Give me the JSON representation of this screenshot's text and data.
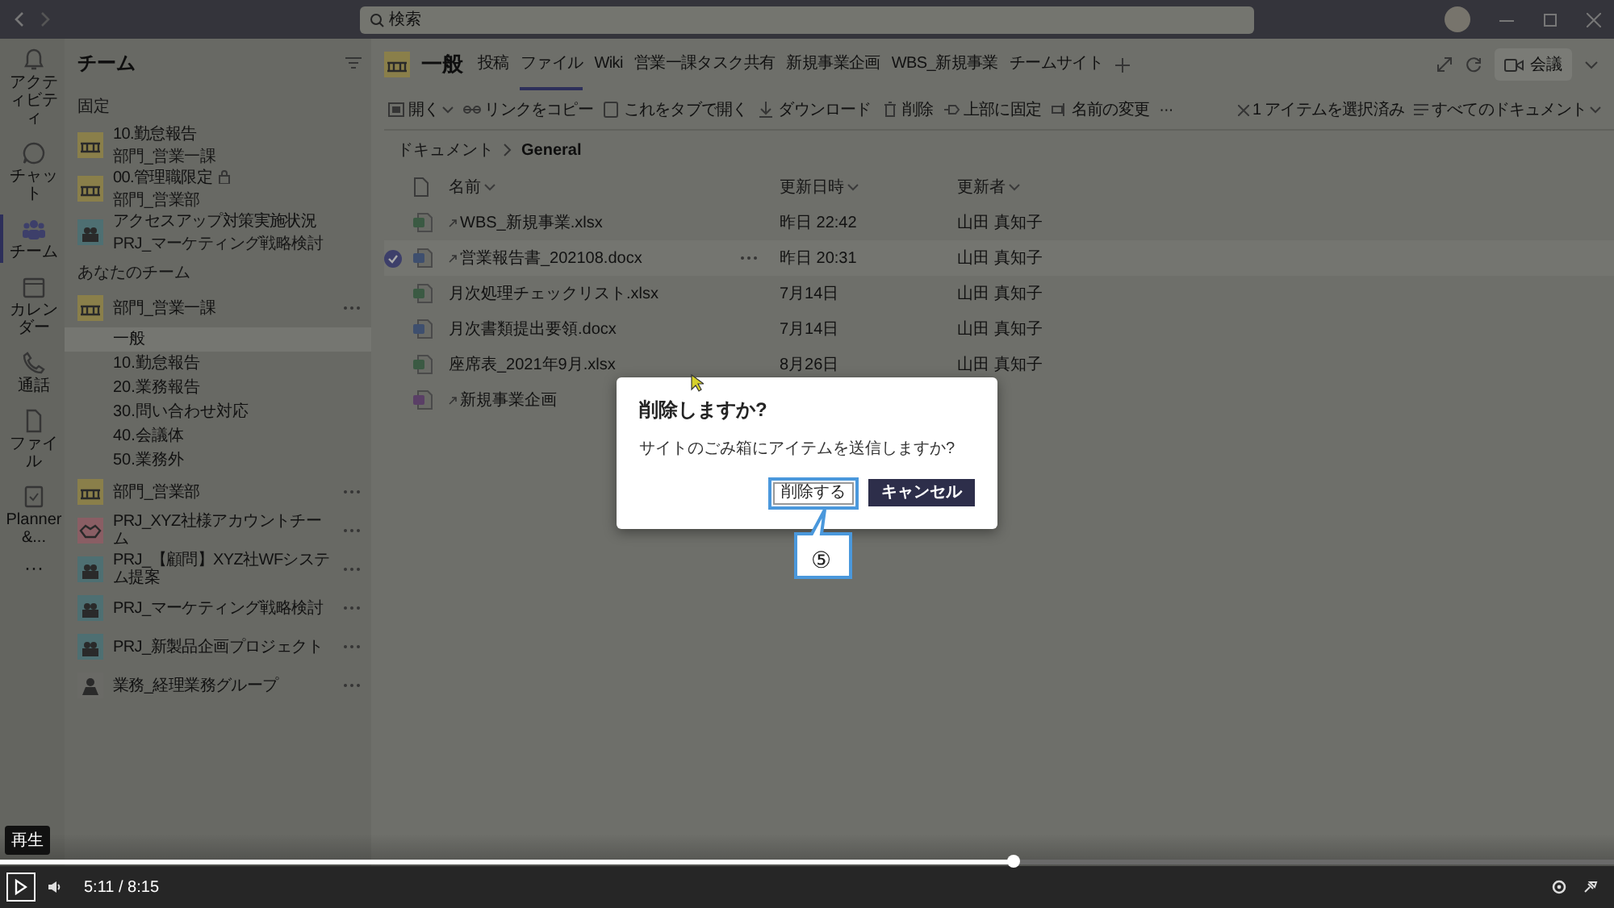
{
  "titlebar": {
    "search": {
      "placeholder": "検索"
    }
  },
  "rail": [
    {
      "kind": "bell",
      "label": "アクティビティ",
      "selected": false
    },
    {
      "kind": "chat",
      "label": "チャット",
      "selected": false
    },
    {
      "kind": "teams",
      "label": "チーム",
      "selected": true
    },
    {
      "kind": "calendar",
      "label": "カレンダー",
      "selected": false
    },
    {
      "kind": "phone",
      "label": "通話",
      "selected": false
    },
    {
      "kind": "file",
      "label": "ファイル",
      "selected": false
    },
    {
      "kind": "planner",
      "label": "Planner &...",
      "selected": false
    },
    {
      "kind": "more",
      "label": "···",
      "selected": false
    }
  ],
  "teams_panel": {
    "title": "チーム",
    "pinned_header": "固定",
    "pinned": [
      {
        "kind": "building",
        "name": "10.勤怠報告",
        "subtitle": "部門_営業一課",
        "locked": false
      },
      {
        "kind": "building",
        "name": "00.管理職限定",
        "subtitle": "部門_営業部",
        "locked": true
      },
      {
        "kind": "people",
        "name": "アクセスアップ対策実施状況",
        "subtitle": "PRJ_マーケティング戦略検討",
        "locked": false
      }
    ],
    "my_header": "あなたのチーム",
    "teams": [
      {
        "kind": "building",
        "name": "部門_営業一課",
        "children": [
          {
            "name": "一般",
            "selected": true
          },
          {
            "name": "10.勤怠報告",
            "selected": false
          },
          {
            "name": "20.業務報告",
            "selected": false
          },
          {
            "name": "30.問い合わせ対応",
            "selected": false
          },
          {
            "name": "40.会議体",
            "selected": false
          },
          {
            "name": "50.業務外",
            "selected": false
          }
        ]
      },
      {
        "kind": "building",
        "name": "部門_営業部"
      },
      {
        "kind": "handshake",
        "name": "PRJ_XYZ社様アカウントチーム"
      },
      {
        "kind": "people",
        "name": "PRJ_【顧問】XYZ社WFシステム提案"
      },
      {
        "kind": "people",
        "name": "PRJ_マーケティング戦略検討"
      },
      {
        "kind": "people",
        "name": "PRJ_新製品企画プロジェクト"
      },
      {
        "kind": "person",
        "name": "業務_経理業務グループ"
      }
    ]
  },
  "channel": {
    "name": "一般",
    "tabs": [
      {
        "label": "投稿",
        "selected": false
      },
      {
        "label": "ファイル",
        "selected": true
      },
      {
        "label": "Wiki",
        "selected": false
      },
      {
        "label": "営業一課タスク共有",
        "selected": false
      },
      {
        "label": "新規事業企画",
        "selected": false
      },
      {
        "label": "WBS_新規事業",
        "selected": false
      },
      {
        "label": "チームサイト",
        "selected": false
      }
    ],
    "meet_button": "会議"
  },
  "toolbar": {
    "actions": [
      {
        "kind": "open",
        "label": "開く"
      },
      {
        "kind": "link",
        "label": "リンクをコピー"
      },
      {
        "kind": "tab",
        "label": "これをタブで開く"
      },
      {
        "kind": "download",
        "label": "ダウンロード"
      },
      {
        "kind": "delete",
        "label": "削除"
      },
      {
        "kind": "pin",
        "label": "上部に固定"
      },
      {
        "kind": "rename",
        "label": "名前の変更"
      },
      {
        "kind": "more",
        "label": "···"
      }
    ],
    "selection": "1 アイテムを選択済み",
    "view": "すべてのドキュメント"
  },
  "breadcrumb": [
    "ドキュメント",
    "General"
  ],
  "table": {
    "columns": [
      "名前",
      "更新日時",
      "更新者"
    ],
    "rows": [
      {
        "kind": "xlsx",
        "name": "WBS_新規事業.xlsx",
        "modified": "昨日 22:42",
        "modified_by": "山田 真知子",
        "new": true,
        "selected": false
      },
      {
        "kind": "docx",
        "name": "営業報告書_202108.docx",
        "modified": "昨日 20:31",
        "modified_by": "山田 真知子",
        "new": true,
        "selected": true
      },
      {
        "kind": "xlsx",
        "name": "月次処理チェックリスト.xlsx",
        "modified": "7月14日",
        "modified_by": "山田 真知子",
        "new": false,
        "selected": false
      },
      {
        "kind": "docx",
        "name": "月次書類提出要領.docx",
        "modified": "7月14日",
        "modified_by": "山田 真知子",
        "new": false,
        "selected": false
      },
      {
        "kind": "xlsx",
        "name": "座席表_2021年9月.xlsx",
        "modified": "8月26日",
        "modified_by": "山田 真知子",
        "new": false,
        "selected": false
      },
      {
        "kind": "onenote",
        "name": "新規事業企画",
        "new": true,
        "selected": false
      }
    ]
  },
  "dialog": {
    "title": "削除しますか?",
    "message": "サイトのごみ箱にアイテムを送信しますか?",
    "confirm": "削除する",
    "cancel": "キャンセル",
    "step": "⑤"
  },
  "player": {
    "tooltip": "再生",
    "time": "5:11 / 8:15",
    "level": 0.628
  }
}
